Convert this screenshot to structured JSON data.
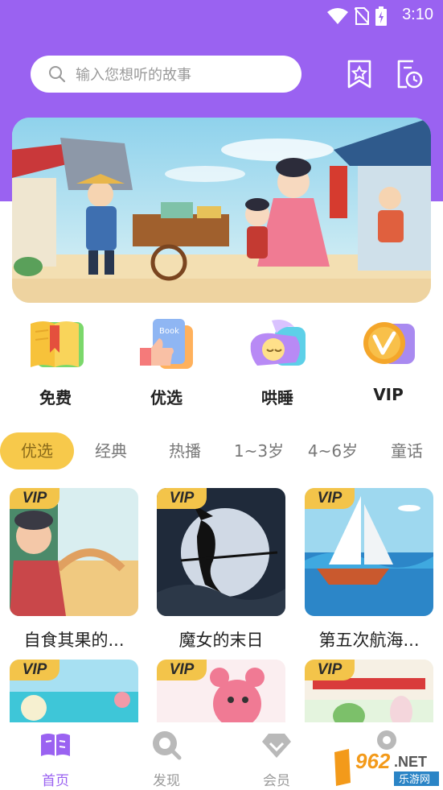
{
  "status_bar": {
    "time": "3:10"
  },
  "search": {
    "placeholder": "输入您想听的故事"
  },
  "header_icons": [
    {
      "name": "favorites-icon"
    },
    {
      "name": "history-icon"
    }
  ],
  "categories": [
    {
      "label": "免费",
      "icon": "book-icon"
    },
    {
      "label": "优选",
      "icon": "thumbs-up-book-icon"
    },
    {
      "label": "哄睡",
      "icon": "moon-pillow-icon"
    },
    {
      "label": "VIP",
      "icon": "vip-coin-icon"
    }
  ],
  "tabs": [
    "优选",
    "经典",
    "热播",
    "1~3岁",
    "4~6岁",
    "童话"
  ],
  "vip_label": "VIP",
  "stories": [
    {
      "title": "自食其果的...",
      "vip": true
    },
    {
      "title": "魔女的末日",
      "vip": true
    },
    {
      "title": "第五次航海...",
      "vip": true
    },
    {
      "title": "",
      "vip": true
    },
    {
      "title": "",
      "vip": true
    },
    {
      "title": "",
      "vip": true
    }
  ],
  "bottom_nav": [
    {
      "label": "首页",
      "icon": "home-book-icon",
      "active": true
    },
    {
      "label": "发现",
      "icon": "discover-icon",
      "active": false
    },
    {
      "label": "会员",
      "icon": "member-diamond-icon",
      "active": false
    },
    {
      "label": "",
      "icon": "profile-icon",
      "active": false
    }
  ],
  "watermark": {
    "number": "962",
    "suffix": ".NET",
    "text": "乐游网"
  },
  "colors": {
    "primary": "#9a62f1",
    "accent_yellow": "#f7c94b"
  }
}
